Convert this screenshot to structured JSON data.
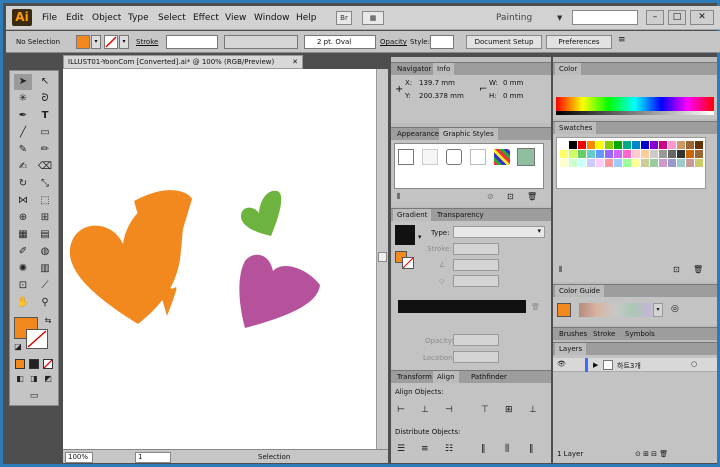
{
  "app": {
    "logo": "Ai",
    "workspace": "Painting"
  },
  "menu": [
    "File",
    "Edit",
    "Object",
    "Type",
    "Select",
    "Effect",
    "View",
    "Window",
    "Help"
  ],
  "menubar_icons": {
    "bridge": "Br",
    "arrange": "▦"
  },
  "control": {
    "selection_label": "No Selection",
    "stroke_label": "Stroke",
    "brush_value": "2 pt. Oval",
    "opacity_label": "Opacity",
    "style_label": "Style:",
    "document_setup": "Document Setup",
    "preferences": "Preferences"
  },
  "document": {
    "tab_title": "ILLUST01-YoonCom [Converted].ai* @ 100% (RGB/Preview)",
    "zoom": "100%",
    "artboard": "1",
    "status": "Selection"
  },
  "navigator": {
    "tabs": [
      "Navigator",
      "Info"
    ],
    "x_label": "X:",
    "x_value": "139.7 mm",
    "y_label": "Y:",
    "y_value": "200.378 mm",
    "w_label": "W:",
    "w_value": "0 mm",
    "h_label": "H:",
    "h_value": "0 mm"
  },
  "appearance": {
    "tabs": [
      "Appearance",
      "Graphic Styles"
    ]
  },
  "gradient": {
    "tabs": [
      "Gradient",
      "Transparency"
    ],
    "type_label": "Type:",
    "stroke_label": "Stroke:",
    "opacity_label": "Opacity:",
    "location_label": "Location:"
  },
  "transform": {
    "tabs": [
      "Transform",
      "Align",
      "Pathfinder"
    ],
    "align_label": "Align Objects:",
    "distribute_label": "Distribute Objects:"
  },
  "color": {
    "tab": "Color"
  },
  "swatches": {
    "tab": "Swatches"
  },
  "color_guide": {
    "tab": "Color Guide"
  },
  "brushes": {
    "tabs": [
      "Brushes",
      "Stroke",
      "Symbols"
    ]
  },
  "layers": {
    "tab": "Layers",
    "layer_name": "하트3개",
    "count": "1 Layer"
  },
  "colors": {
    "heart_orange": "#f2891f",
    "heart_green": "#6db33f",
    "heart_purple": "#b6529c",
    "fill": "#f2891f"
  }
}
